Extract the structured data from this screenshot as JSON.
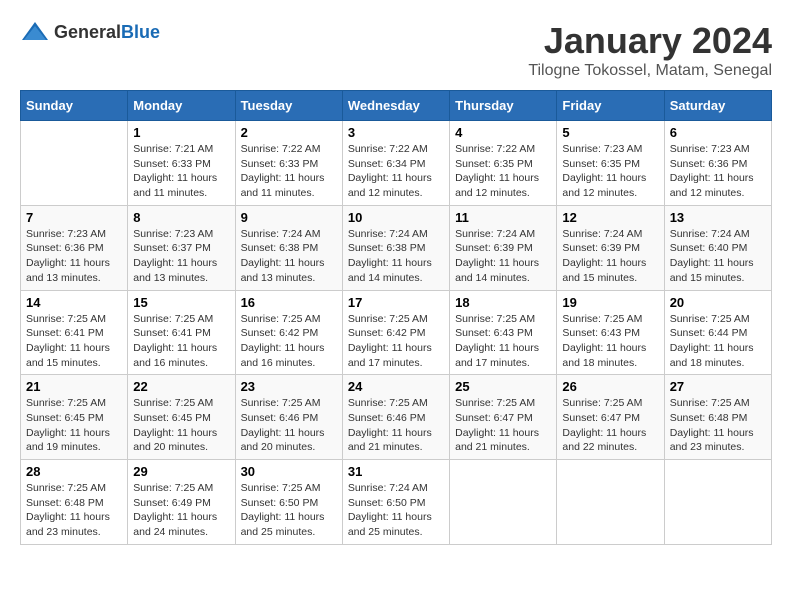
{
  "header": {
    "logo_general": "General",
    "logo_blue": "Blue",
    "title": "January 2024",
    "subtitle": "Tilogne Tokossel, Matam, Senegal"
  },
  "days": [
    "Sunday",
    "Monday",
    "Tuesday",
    "Wednesday",
    "Thursday",
    "Friday",
    "Saturday"
  ],
  "weeks": [
    [
      {
        "date": "",
        "lines": []
      },
      {
        "date": "1",
        "lines": [
          "Sunrise: 7:21 AM",
          "Sunset: 6:33 PM",
          "Daylight: 11 hours",
          "and 11 minutes."
        ]
      },
      {
        "date": "2",
        "lines": [
          "Sunrise: 7:22 AM",
          "Sunset: 6:33 PM",
          "Daylight: 11 hours",
          "and 11 minutes."
        ]
      },
      {
        "date": "3",
        "lines": [
          "Sunrise: 7:22 AM",
          "Sunset: 6:34 PM",
          "Daylight: 11 hours",
          "and 12 minutes."
        ]
      },
      {
        "date": "4",
        "lines": [
          "Sunrise: 7:22 AM",
          "Sunset: 6:35 PM",
          "Daylight: 11 hours",
          "and 12 minutes."
        ]
      },
      {
        "date": "5",
        "lines": [
          "Sunrise: 7:23 AM",
          "Sunset: 6:35 PM",
          "Daylight: 11 hours",
          "and 12 minutes."
        ]
      },
      {
        "date": "6",
        "lines": [
          "Sunrise: 7:23 AM",
          "Sunset: 6:36 PM",
          "Daylight: 11 hours",
          "and 12 minutes."
        ]
      }
    ],
    [
      {
        "date": "7",
        "lines": [
          "Sunrise: 7:23 AM",
          "Sunset: 6:36 PM",
          "Daylight: 11 hours",
          "and 13 minutes."
        ]
      },
      {
        "date": "8",
        "lines": [
          "Sunrise: 7:23 AM",
          "Sunset: 6:37 PM",
          "Daylight: 11 hours",
          "and 13 minutes."
        ]
      },
      {
        "date": "9",
        "lines": [
          "Sunrise: 7:24 AM",
          "Sunset: 6:38 PM",
          "Daylight: 11 hours",
          "and 13 minutes."
        ]
      },
      {
        "date": "10",
        "lines": [
          "Sunrise: 7:24 AM",
          "Sunset: 6:38 PM",
          "Daylight: 11 hours",
          "and 14 minutes."
        ]
      },
      {
        "date": "11",
        "lines": [
          "Sunrise: 7:24 AM",
          "Sunset: 6:39 PM",
          "Daylight: 11 hours",
          "and 14 minutes."
        ]
      },
      {
        "date": "12",
        "lines": [
          "Sunrise: 7:24 AM",
          "Sunset: 6:39 PM",
          "Daylight: 11 hours",
          "and 15 minutes."
        ]
      },
      {
        "date": "13",
        "lines": [
          "Sunrise: 7:24 AM",
          "Sunset: 6:40 PM",
          "Daylight: 11 hours",
          "and 15 minutes."
        ]
      }
    ],
    [
      {
        "date": "14",
        "lines": [
          "Sunrise: 7:25 AM",
          "Sunset: 6:41 PM",
          "Daylight: 11 hours",
          "and 15 minutes."
        ]
      },
      {
        "date": "15",
        "lines": [
          "Sunrise: 7:25 AM",
          "Sunset: 6:41 PM",
          "Daylight: 11 hours",
          "and 16 minutes."
        ]
      },
      {
        "date": "16",
        "lines": [
          "Sunrise: 7:25 AM",
          "Sunset: 6:42 PM",
          "Daylight: 11 hours",
          "and 16 minutes."
        ]
      },
      {
        "date": "17",
        "lines": [
          "Sunrise: 7:25 AM",
          "Sunset: 6:42 PM",
          "Daylight: 11 hours",
          "and 17 minutes."
        ]
      },
      {
        "date": "18",
        "lines": [
          "Sunrise: 7:25 AM",
          "Sunset: 6:43 PM",
          "Daylight: 11 hours",
          "and 17 minutes."
        ]
      },
      {
        "date": "19",
        "lines": [
          "Sunrise: 7:25 AM",
          "Sunset: 6:43 PM",
          "Daylight: 11 hours",
          "and 18 minutes."
        ]
      },
      {
        "date": "20",
        "lines": [
          "Sunrise: 7:25 AM",
          "Sunset: 6:44 PM",
          "Daylight: 11 hours",
          "and 18 minutes."
        ]
      }
    ],
    [
      {
        "date": "21",
        "lines": [
          "Sunrise: 7:25 AM",
          "Sunset: 6:45 PM",
          "Daylight: 11 hours",
          "and 19 minutes."
        ]
      },
      {
        "date": "22",
        "lines": [
          "Sunrise: 7:25 AM",
          "Sunset: 6:45 PM",
          "Daylight: 11 hours",
          "and 20 minutes."
        ]
      },
      {
        "date": "23",
        "lines": [
          "Sunrise: 7:25 AM",
          "Sunset: 6:46 PM",
          "Daylight: 11 hours",
          "and 20 minutes."
        ]
      },
      {
        "date": "24",
        "lines": [
          "Sunrise: 7:25 AM",
          "Sunset: 6:46 PM",
          "Daylight: 11 hours",
          "and 21 minutes."
        ]
      },
      {
        "date": "25",
        "lines": [
          "Sunrise: 7:25 AM",
          "Sunset: 6:47 PM",
          "Daylight: 11 hours",
          "and 21 minutes."
        ]
      },
      {
        "date": "26",
        "lines": [
          "Sunrise: 7:25 AM",
          "Sunset: 6:47 PM",
          "Daylight: 11 hours",
          "and 22 minutes."
        ]
      },
      {
        "date": "27",
        "lines": [
          "Sunrise: 7:25 AM",
          "Sunset: 6:48 PM",
          "Daylight: 11 hours",
          "and 23 minutes."
        ]
      }
    ],
    [
      {
        "date": "28",
        "lines": [
          "Sunrise: 7:25 AM",
          "Sunset: 6:48 PM",
          "Daylight: 11 hours",
          "and 23 minutes."
        ]
      },
      {
        "date": "29",
        "lines": [
          "Sunrise: 7:25 AM",
          "Sunset: 6:49 PM",
          "Daylight: 11 hours",
          "and 24 minutes."
        ]
      },
      {
        "date": "30",
        "lines": [
          "Sunrise: 7:25 AM",
          "Sunset: 6:50 PM",
          "Daylight: 11 hours",
          "and 25 minutes."
        ]
      },
      {
        "date": "31",
        "lines": [
          "Sunrise: 7:24 AM",
          "Sunset: 6:50 PM",
          "Daylight: 11 hours",
          "and 25 minutes."
        ]
      },
      {
        "date": "",
        "lines": []
      },
      {
        "date": "",
        "lines": []
      },
      {
        "date": "",
        "lines": []
      }
    ]
  ]
}
